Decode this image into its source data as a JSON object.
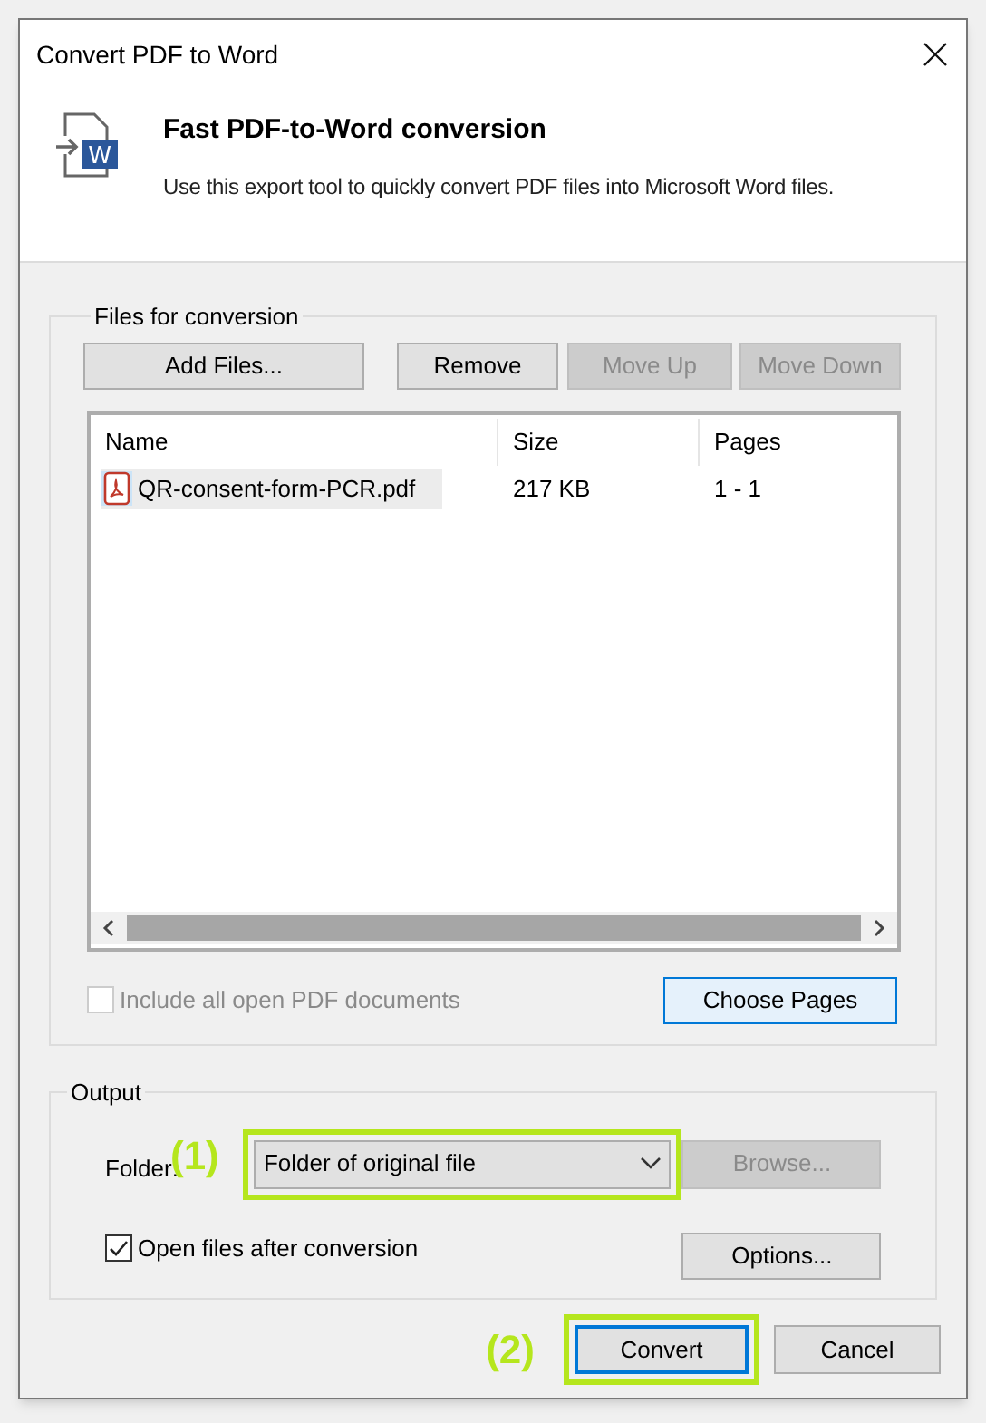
{
  "window": {
    "title": "Convert PDF to Word"
  },
  "header": {
    "icon_letter": "W",
    "title": "Fast PDF-to-Word conversion",
    "description": "Use this export tool to quickly convert PDF files into Microsoft Word files."
  },
  "files_group": {
    "label": "Files for conversion",
    "buttons": [
      {
        "label": "Add Files...",
        "disabled": false
      },
      {
        "label": "Remove",
        "disabled": false
      },
      {
        "label": "Move Up",
        "disabled": true
      },
      {
        "label": "Move Down",
        "disabled": true
      }
    ],
    "table": {
      "columns": [
        "Name",
        "Size",
        "Pages"
      ],
      "rows": [
        {
          "name": "QR-consent-form-PCR.pdf",
          "size": "217 KB",
          "pages": "1 - 1",
          "selected": true
        }
      ]
    },
    "include_all": {
      "label": "Include all open PDF documents",
      "checked": false,
      "disabled": true
    },
    "choose_pages": {
      "label": "Choose Pages",
      "focused": true
    }
  },
  "output_group": {
    "label": "Output",
    "folder_label": "Folder:",
    "folder": {
      "value": "Folder of original file",
      "highlighted": true,
      "annotation": "(1)"
    },
    "browse": {
      "label": "Browse...",
      "disabled": true
    },
    "open_after": {
      "label": "Open files after conversion",
      "checked": true
    },
    "options": {
      "label": "Options..."
    }
  },
  "footer": {
    "convert": {
      "label": "Convert",
      "highlighted": true,
      "annotation": "(2)",
      "default": true
    },
    "cancel": {
      "label": "Cancel"
    }
  }
}
